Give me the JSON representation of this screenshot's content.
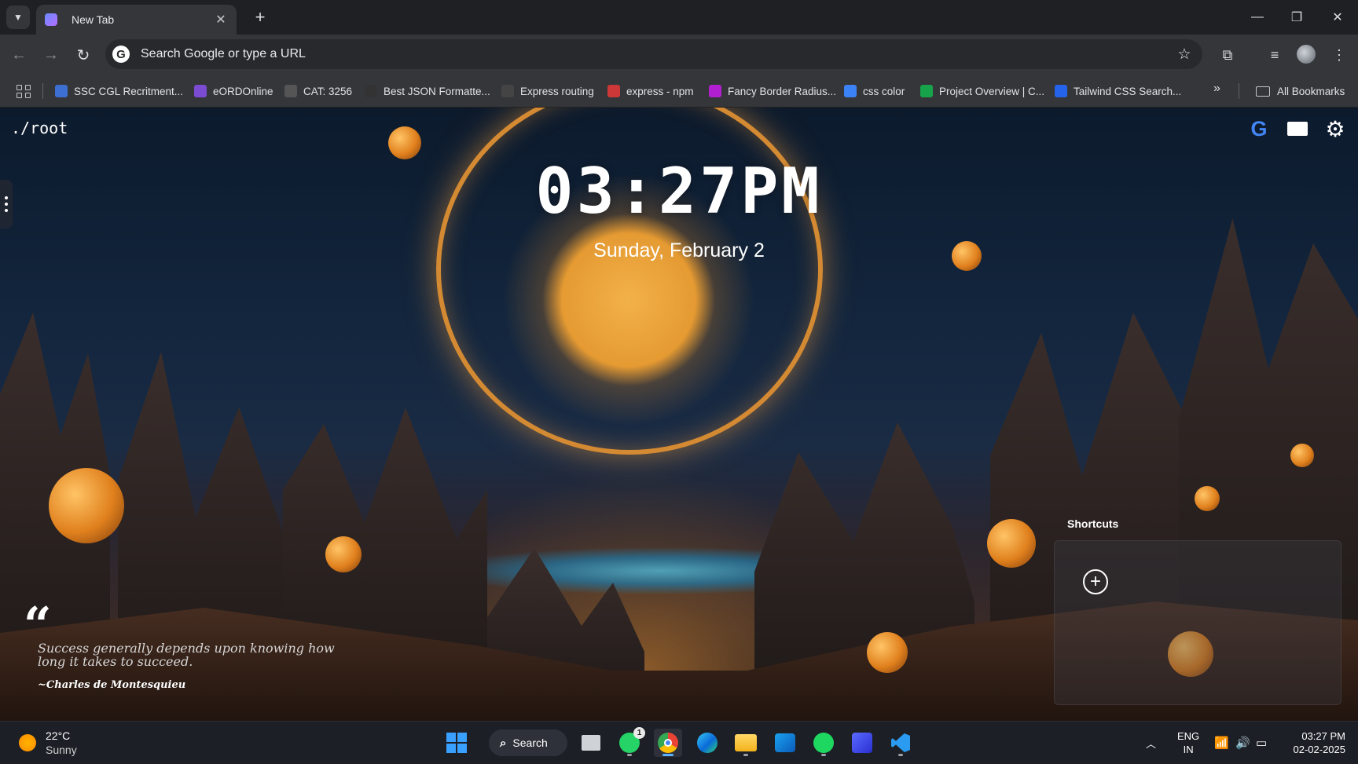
{
  "browser": {
    "tab_title": "New Tab",
    "omnibox_placeholder": "Search Google or type a URL",
    "bookmarks": [
      {
        "label": "SSC CGL Recritment...",
        "icon": "ssc-favicon",
        "color": "#3c6fd1"
      },
      {
        "label": "eORDOnline",
        "icon": "eord-favicon",
        "color": "#7b4bd1"
      },
      {
        "label": "CAT: 3256",
        "icon": "d-favicon",
        "color": "#555555"
      },
      {
        "label": "Best JSON Formatte...",
        "icon": "jf-favicon",
        "color": "#333333"
      },
      {
        "label": "Express routing",
        "icon": "ex-favicon",
        "color": "#444444"
      },
      {
        "label": "express - npm",
        "icon": "npm-favicon",
        "color": "#cb3837"
      },
      {
        "label": "Fancy Border Radius...",
        "icon": "fancy-favicon",
        "color": "#b21fd1"
      },
      {
        "label": "css color",
        "icon": "css-favicon",
        "color": "#3b82f6"
      },
      {
        "label": "Project Overview | C...",
        "icon": "project-favicon",
        "color": "#16a34a"
      },
      {
        "label": "Tailwind CSS Search...",
        "icon": "tailwind-favicon",
        "color": "#2563eb"
      }
    ],
    "all_bookmarks_label": "All Bookmarks",
    "more_glyph": "»"
  },
  "page": {
    "root_label": "./root",
    "time": "03:27PM",
    "date": "Sunday, February 2",
    "quote_mark": "“",
    "quote_text": "Success generally depends upon knowing how long it takes to succeed.",
    "quote_author": "~Charles de Montesquieu",
    "shortcuts_title": "Shortcuts",
    "add_glyph": "+",
    "google_glyph": "G",
    "gear_glyph": "⚙"
  },
  "taskbar": {
    "weather_temp": "22°C",
    "weather_cond": "Sunny",
    "search_label": "Search",
    "whatsapp_badge": "1",
    "lang_top": "ENG",
    "lang_bottom": "IN",
    "time": "03:27 PM",
    "date": "02-02-2025"
  }
}
